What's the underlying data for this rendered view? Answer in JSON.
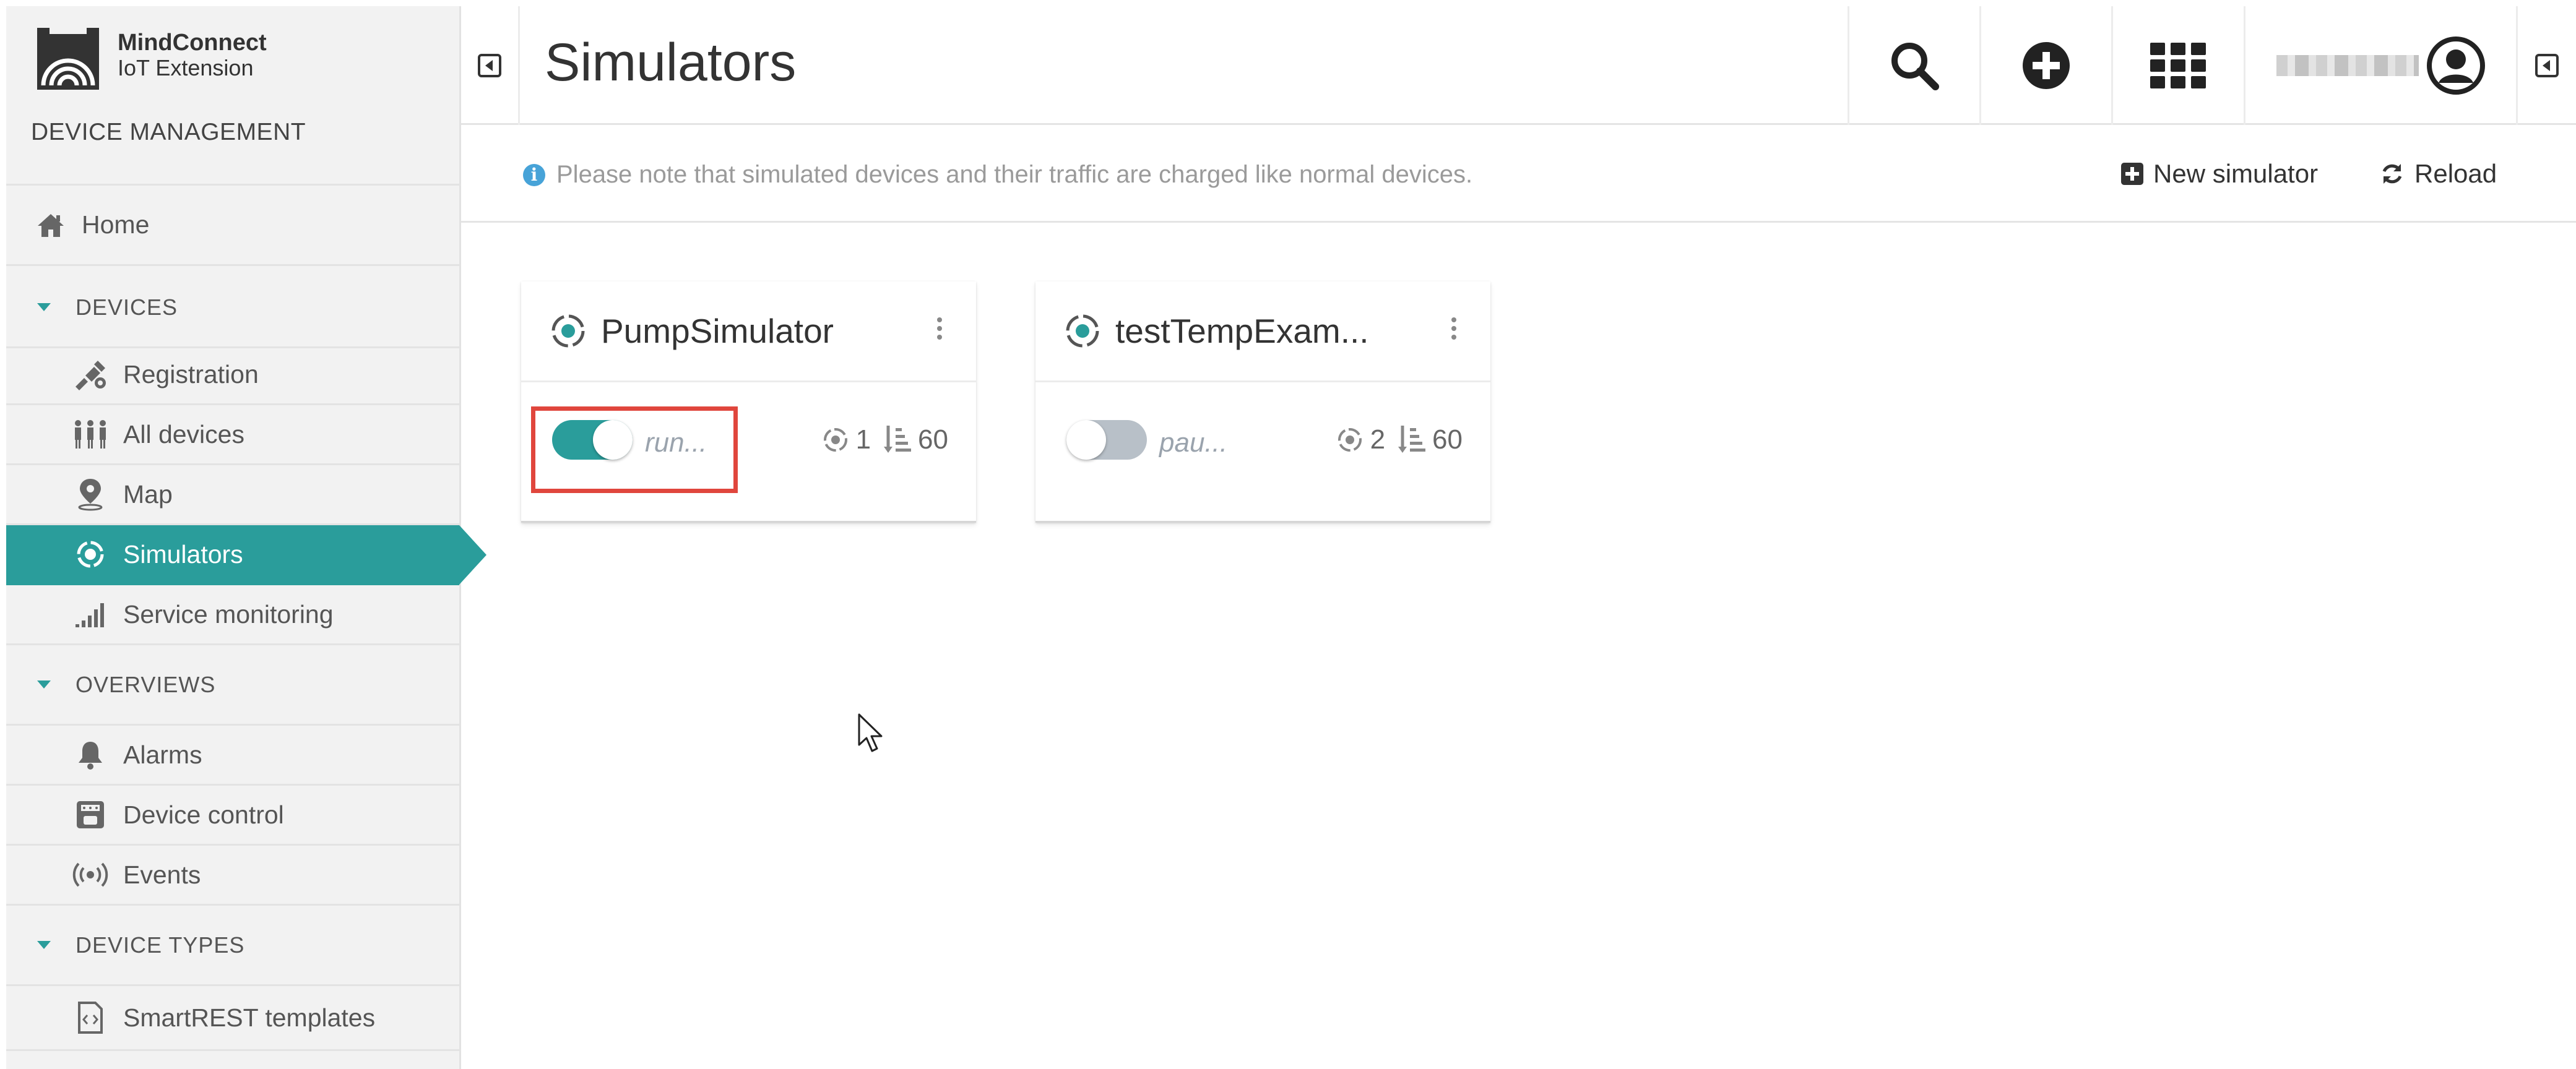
{
  "app": {
    "brand_name": "MindConnect",
    "brand_sub": "IoT Extension",
    "section_title": "DEVICE MANAGEMENT"
  },
  "header": {
    "title": "Simulators",
    "icons": [
      "search-icon",
      "add-circle-icon",
      "app-grid-icon",
      "user-avatar-icon"
    ]
  },
  "sidebar": {
    "home": "Home",
    "sections": [
      {
        "label": "DEVICES",
        "items": [
          {
            "label": "Registration",
            "icon": "registration-icon"
          },
          {
            "label": "All devices",
            "icon": "all-devices-icon"
          },
          {
            "label": "Map",
            "icon": "map-pin-icon"
          },
          {
            "label": "Simulators",
            "icon": "simulator-icon",
            "active": true
          },
          {
            "label": "Service monitoring",
            "icon": "signal-bars-icon"
          }
        ]
      },
      {
        "label": "OVERVIEWS",
        "items": [
          {
            "label": "Alarms",
            "icon": "bell-icon"
          },
          {
            "label": "Device control",
            "icon": "device-control-icon"
          },
          {
            "label": "Events",
            "icon": "broadcast-icon"
          }
        ]
      },
      {
        "label": "DEVICE TYPES",
        "items": [
          {
            "label": "SmartREST templates",
            "icon": "template-file-icon"
          }
        ]
      }
    ]
  },
  "actionbar": {
    "note": "Please note that simulated devices and their traffic are charged like normal devices.",
    "new_simulator": "New simulator",
    "reload": "Reload"
  },
  "simulators": [
    {
      "name": "PumpSimulator",
      "status": "run...",
      "running": true,
      "instances": "1",
      "steps": "60"
    },
    {
      "name": "testTempExam...",
      "status": "pau...",
      "running": false,
      "instances": "2",
      "steps": "60"
    }
  ],
  "colors": {
    "accent": "#2a9d9b",
    "highlight": "#e0463d",
    "toggle_off": "#b8c0c8"
  }
}
